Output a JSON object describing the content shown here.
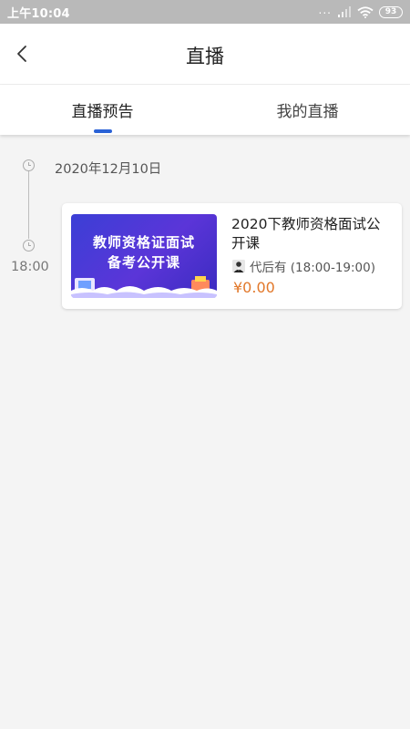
{
  "status_bar": {
    "time": "上午10:04",
    "signal_dots": "...",
    "battery": "93"
  },
  "nav": {
    "title": "直播"
  },
  "tabs": [
    {
      "label": "直播预告",
      "active": true
    },
    {
      "label": "我的直播",
      "active": false
    }
  ],
  "timeline": {
    "date": "2020年12月10日",
    "time": "18:00"
  },
  "course": {
    "cover_line_1": "教师资格证面试",
    "cover_line_2": "备考公开课",
    "title": "2020下教师资格面试公开课",
    "teacher": "代后有 (18:00-19:00)",
    "price": "¥0.00"
  },
  "colors": {
    "accent": "#2a62d6",
    "price": "#e2782a",
    "status_bar": "#b9b9b9"
  }
}
